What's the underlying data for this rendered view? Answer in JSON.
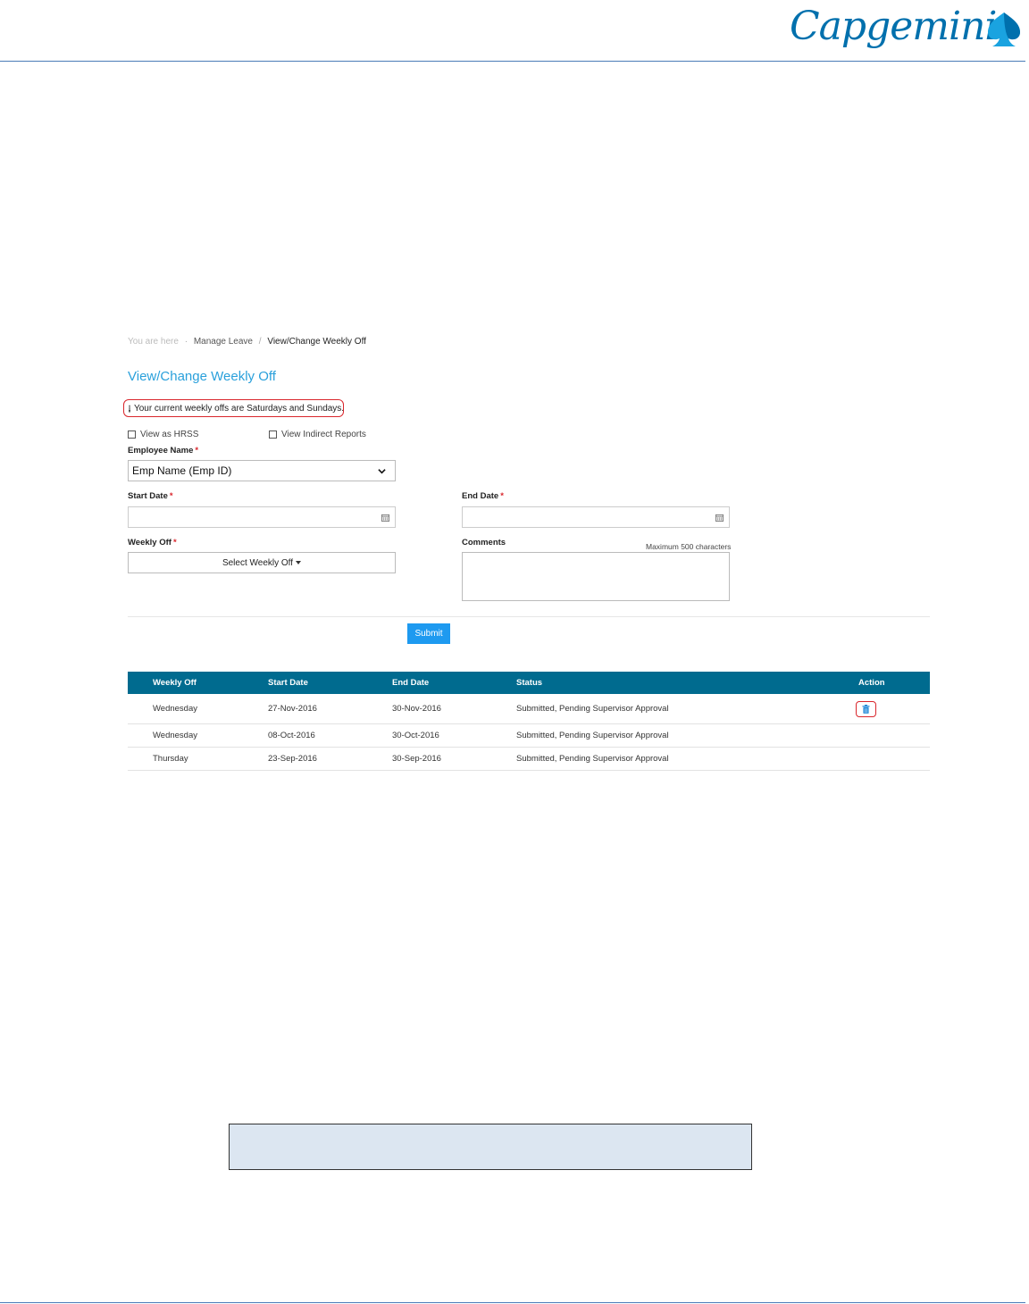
{
  "header": {
    "logo_text": "Capgemini"
  },
  "breadcrumb": {
    "prefix": "You are here",
    "parent": "Manage Leave",
    "separator": "/",
    "current": "View/Change Weekly Off"
  },
  "page": {
    "title": "View/Change Weekly Off"
  },
  "notice": {
    "text": "Your current weekly offs are Saturdays and Sundays."
  },
  "checkboxes": {
    "view_as_hrss": "View as HRSS",
    "view_indirect": "View Indirect Reports"
  },
  "form": {
    "employee_label": "Employee Name",
    "employee_value": "Emp Name (Emp ID)",
    "start_label": "Start Date",
    "end_label": "End Date",
    "weekly_label": "Weekly Off",
    "weekly_button": "Select Weekly Off",
    "comments_label": "Comments",
    "comments_max": "Maximum 500 characters",
    "required_mark": "*",
    "submit": "Submit"
  },
  "table": {
    "headers": [
      "Weekly Off",
      "Start Date",
      "End Date",
      "Status",
      "Action"
    ],
    "rows": [
      {
        "weekly": "Wednesday",
        "start": "27-Nov-2016",
        "end": "30-Nov-2016",
        "status": "Submitted, Pending Supervisor Approval"
      },
      {
        "weekly": "Wednesday",
        "start": "08-Oct-2016",
        "end": "30-Oct-2016",
        "status": "Submitted, Pending Supervisor Approval"
      },
      {
        "weekly": "Thursday",
        "start": "23-Sep-2016",
        "end": "30-Sep-2016",
        "status": "Submitted, Pending Supervisor Approval"
      }
    ]
  },
  "colors": {
    "accent": "#2aa0db",
    "table_header": "#006b8f",
    "submit": "#1e9af0",
    "highlight": "#d9262c",
    "brand": "#0070ad"
  }
}
